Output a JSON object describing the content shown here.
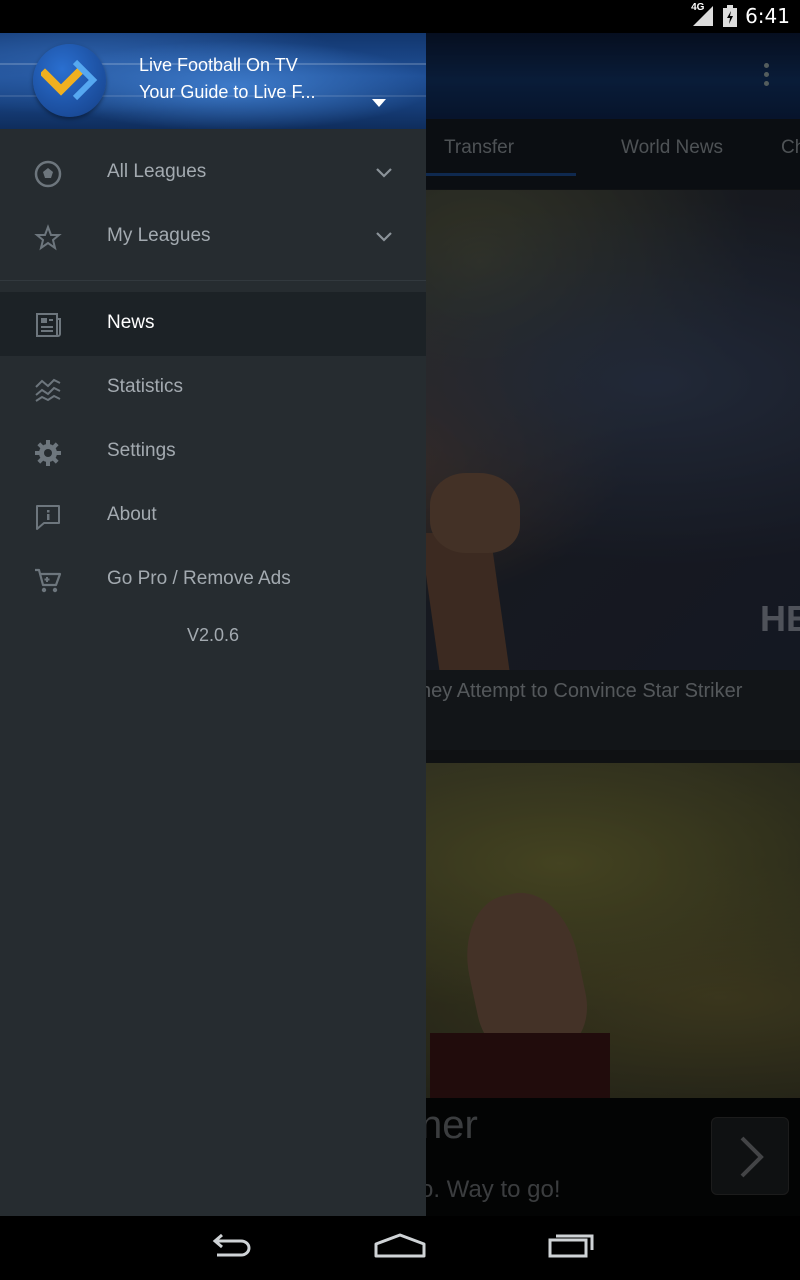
{
  "status_bar": {
    "network": "4G",
    "time": "6:41"
  },
  "background": {
    "tabs": [
      "Transfer",
      "World News",
      "Ch"
    ],
    "active_tab": "Transfer",
    "article1_caption": "hey Attempt to Convince Star Striker",
    "article2_headline": "ner",
    "article2_sub": "o. Way to go!",
    "jersey_text": "HE"
  },
  "drawer": {
    "app_name": "Live Football On TV",
    "app_subtitle": "Your Guide to Live F...",
    "items": [
      {
        "label": "All Leagues",
        "icon": "soccer-ball-icon",
        "expandable": true
      },
      {
        "label": "My Leagues",
        "icon": "star-icon",
        "expandable": true
      },
      {
        "label": "News",
        "icon": "newspaper-icon",
        "active": true
      },
      {
        "label": "Statistics",
        "icon": "statistics-icon"
      },
      {
        "label": "Settings",
        "icon": "gear-icon"
      },
      {
        "label": "About",
        "icon": "info-icon"
      },
      {
        "label": "Go Pro / Remove Ads",
        "icon": "cart-icon"
      }
    ],
    "version": "V2.0.6"
  },
  "colors": {
    "drawer_bg": "#262c30",
    "active_item_bg": "#1c2226",
    "accent": "#1c4b90",
    "text_muted": "#a3aab0"
  }
}
